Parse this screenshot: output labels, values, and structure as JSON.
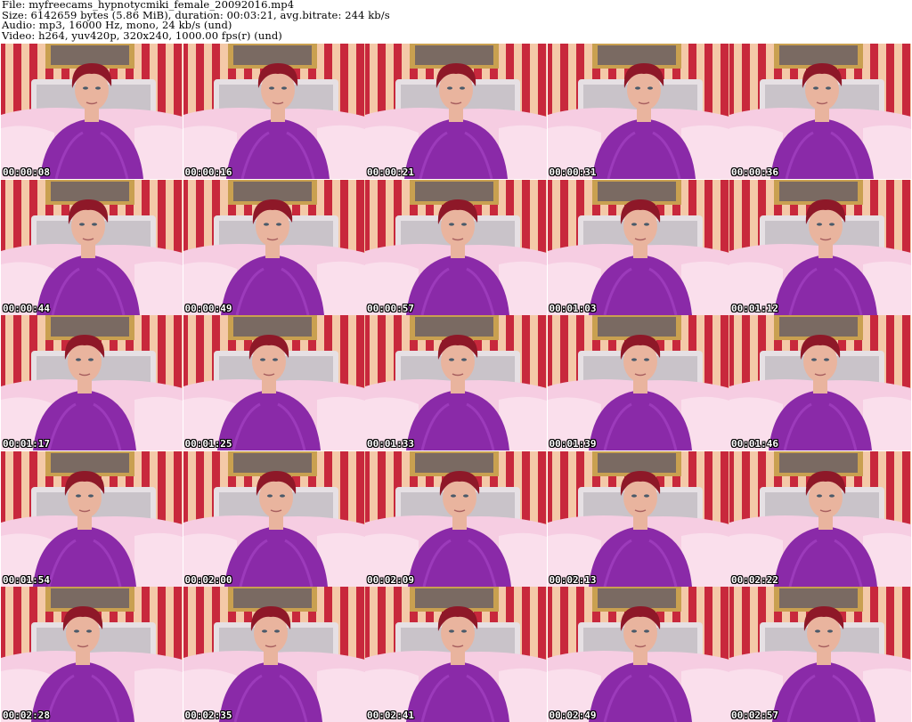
{
  "header": {
    "file_line": "File: myfreecams_hypnotycmiki_female_20092016.mp4",
    "size_line": "Size: 6142659 bytes (5.86 MiB), duration: 00:03:21, avg.bitrate: 244 kb/s",
    "audio_line": "Audio: mp3, 16000 Hz, mono, 24 kb/s (und)",
    "video_line": "Video: h264, yuv420p, 320x240, 1000.00 fps(r) (und)"
  },
  "thumbnails": [
    {
      "timestamp": "00:00:08"
    },
    {
      "timestamp": "00:00:16"
    },
    {
      "timestamp": "00:00:21"
    },
    {
      "timestamp": "00:00:31"
    },
    {
      "timestamp": "00:00:36"
    },
    {
      "timestamp": "00:00:44"
    },
    {
      "timestamp": "00:00:49"
    },
    {
      "timestamp": "00:00:57"
    },
    {
      "timestamp": "00:01:03"
    },
    {
      "timestamp": "00:01:12"
    },
    {
      "timestamp": "00:01:17"
    },
    {
      "timestamp": "00:01:25"
    },
    {
      "timestamp": "00:01:33"
    },
    {
      "timestamp": "00:01:39"
    },
    {
      "timestamp": "00:01:46"
    },
    {
      "timestamp": "00:01:54"
    },
    {
      "timestamp": "00:02:00"
    },
    {
      "timestamp": "00:02:09"
    },
    {
      "timestamp": "00:02:13"
    },
    {
      "timestamp": "00:02:22"
    },
    {
      "timestamp": "00:02:28"
    },
    {
      "timestamp": "00:02:35"
    },
    {
      "timestamp": "00:02:41"
    },
    {
      "timestamp": "00:02:49"
    },
    {
      "timestamp": "00:02:57"
    }
  ],
  "colors": {
    "wall_stripe_red": "#c8283c",
    "wall_stripe_light": "#f4c9a8",
    "bed_pink": "#f6cde2",
    "headboard": "#e6e0e4",
    "top_purple": "#8a2aa8",
    "hair_red": "#8e1828",
    "skin": "#e9b49e",
    "frame_gold": "#c9a050"
  }
}
